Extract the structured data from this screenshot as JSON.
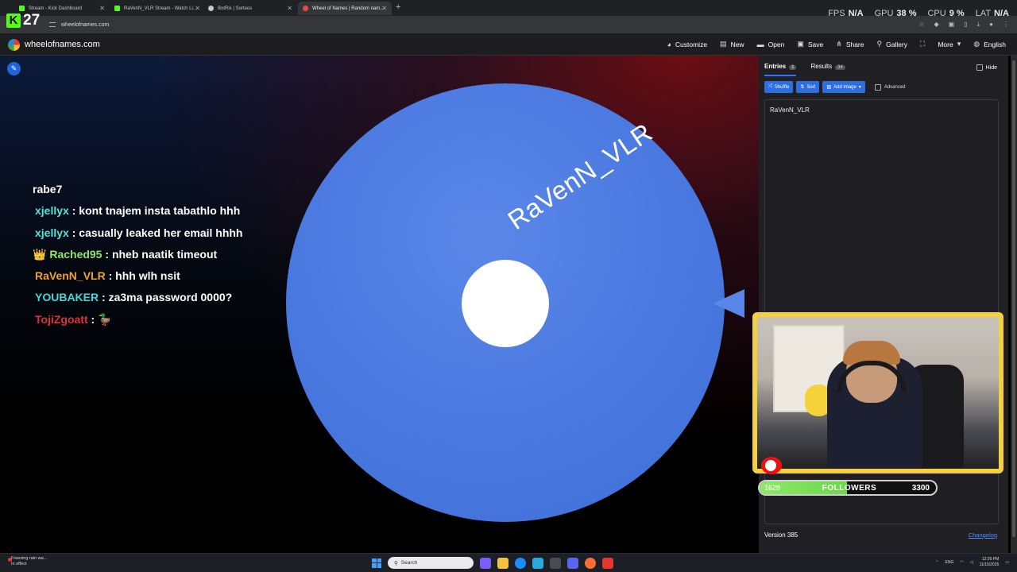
{
  "browser": {
    "tabs": [
      {
        "title": "Stream - Kick Dashboard",
        "active": false,
        "favicon_color": "#53fc18"
      },
      {
        "title": "RaVenN_VLR Stream - Watch Li...",
        "active": false,
        "favicon_color": "#53fc18"
      },
      {
        "title": "BotRix | Sorteos",
        "active": false,
        "favicon_color": "#c8c8c8"
      },
      {
        "title": "Wheel of Names | Random nam...",
        "active": true,
        "favicon_color": "#e74c3c"
      }
    ],
    "new_tab": "+",
    "url": "wheelofnames.com",
    "stats": {
      "fps_label": "FPS",
      "fps_value": "N/A",
      "gpu_label": "GPU",
      "gpu_value": "38 %",
      "cpu_label": "CPU",
      "cpu_value": "9 %",
      "lat_label": "LAT",
      "lat_value": "N/A"
    },
    "kick_badge": {
      "letter": "K",
      "count": "27"
    }
  },
  "app": {
    "brand": "wheelofnames.com",
    "menu": [
      {
        "icon": "palette-icon",
        "glyph": "◕",
        "label": "Customize"
      },
      {
        "icon": "new-file-icon",
        "glyph": "▤",
        "label": "New"
      },
      {
        "icon": "folder-icon",
        "glyph": "▬",
        "label": "Open"
      },
      {
        "icon": "save-icon",
        "glyph": "▣",
        "label": "Save"
      },
      {
        "icon": "share-icon",
        "glyph": "⋔",
        "label": "Share"
      },
      {
        "icon": "search-icon",
        "glyph": "⚲",
        "label": "Gallery"
      },
      {
        "icon": "fullscreen-icon",
        "glyph": "⛶",
        "label": ""
      },
      {
        "icon": "chevron-down-icon",
        "glyph": "▾",
        "label": "More"
      },
      {
        "icon": "globe-icon",
        "glyph": "◍",
        "label": "English"
      }
    ]
  },
  "wheel": {
    "segments": [
      "RaVenN_VLR"
    ],
    "segment_color": "#4a79e0"
  },
  "chat": [
    {
      "user": "rabe7",
      "user_color": "#ffffff",
      "text": "",
      "badge": ""
    },
    {
      "user": "xjellyx",
      "user_color": "#5ce0d8",
      "text": "kont tnajem insta tabathlo hhh",
      "badge": ""
    },
    {
      "user": "xjellyx",
      "user_color": "#5ce0d8",
      "text": "casually leaked her email hhhh",
      "badge": ""
    },
    {
      "user": "Rached95",
      "user_color": "#8ee86a",
      "text": "nheb naatik timeout",
      "badge": "👑"
    },
    {
      "user": "RaVenN_VLR",
      "user_color": "#f0a030",
      "text": "hhh wlh nsit",
      "badge": ""
    },
    {
      "user": "YOUBAKER",
      "user_color": "#40d9d9",
      "text": "za3ma password 0000?",
      "badge": ""
    },
    {
      "user": "TojiZgoatt",
      "user_color": "#e0303a",
      "text": "🦆",
      "badge": ""
    }
  ],
  "panel": {
    "tabs": [
      {
        "label": "Entries",
        "count": "1",
        "active": true
      },
      {
        "label": "Results",
        "count": "34",
        "active": false
      }
    ],
    "hide_label": "Hide",
    "tools": [
      {
        "icon": "shuffle-icon",
        "glyph": "⤮",
        "label": "Shuffle"
      },
      {
        "icon": "sort-icon",
        "glyph": "⇅",
        "label": "Sort"
      },
      {
        "icon": "image-icon",
        "glyph": "▨",
        "label": "Add image"
      }
    ],
    "advanced_label": "Advanced",
    "entries_text": "RaVenN_VLR",
    "version": "Version 385",
    "changelog": "Changelog"
  },
  "overlay": {
    "followers_current": "1629",
    "followers_label": "FOLLOWERS",
    "followers_goal": "3300",
    "followers_progress": 0.4936
  },
  "taskbar": {
    "weather_line1": "Freezing rain wa...",
    "weather_line2": "In effect",
    "search_placeholder": "Search",
    "apps": [
      "#7a5cff",
      "#f6c244",
      "#1a8cff",
      "#2aa8e0",
      "#4a4a52",
      "#5865f2",
      "#ff6b35",
      "#e2382f"
    ],
    "lang": "ENG",
    "time": "12:26 PM",
    "date": "11/15/2025"
  }
}
